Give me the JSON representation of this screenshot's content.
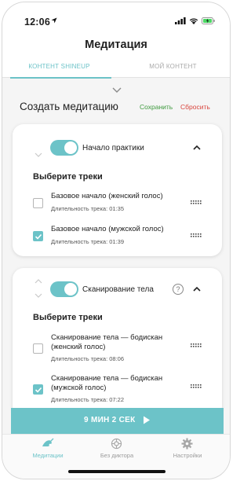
{
  "status_bar": {
    "time": "12:06"
  },
  "header": {
    "title": "Медитация"
  },
  "tabs": [
    {
      "label": "КОНТЕНТ SHINEUP",
      "active": true
    },
    {
      "label": "МОЙ КОНТЕНТ",
      "active": false
    }
  ],
  "section": {
    "title": "Создать медитацию",
    "save_label": "Сохранить",
    "reset_label": "Сбросить"
  },
  "blocks": [
    {
      "title": "Начало практики",
      "enabled": true,
      "choose_label": "Выберите треки",
      "tracks": [
        {
          "name": "Базовое начало (женский голос)",
          "duration": "Длительность трека: 01:35",
          "checked": false
        },
        {
          "name": "Базовое начало (мужской голос)",
          "duration": "Длительность трека: 01:39",
          "checked": true
        }
      ]
    },
    {
      "title": "Сканирование тела",
      "enabled": true,
      "help_icon_text": "?",
      "choose_label": "Выберите треки",
      "tracks": [
        {
          "name": "Сканирование тела — бодискан (женский голос)",
          "duration": "Длительность трека: 08:06",
          "checked": false
        },
        {
          "name": "Сканирование тела — бодискан (мужской голос)",
          "duration": "Длительность трека: 07:22",
          "checked": true
        }
      ]
    }
  ],
  "playbar": {
    "label": "9 МИН 2 СЕК"
  },
  "bottom_nav": [
    {
      "label": "Медитации",
      "icon": "meditation-icon",
      "active": true
    },
    {
      "label": "Без диктора",
      "icon": "no-narrator-icon",
      "active": false
    },
    {
      "label": "Настройки",
      "icon": "settings-gear-icon",
      "active": false
    }
  ],
  "colors": {
    "accent": "#6cc3c8",
    "save": "#3f9a3f",
    "reset": "#d9443c"
  }
}
